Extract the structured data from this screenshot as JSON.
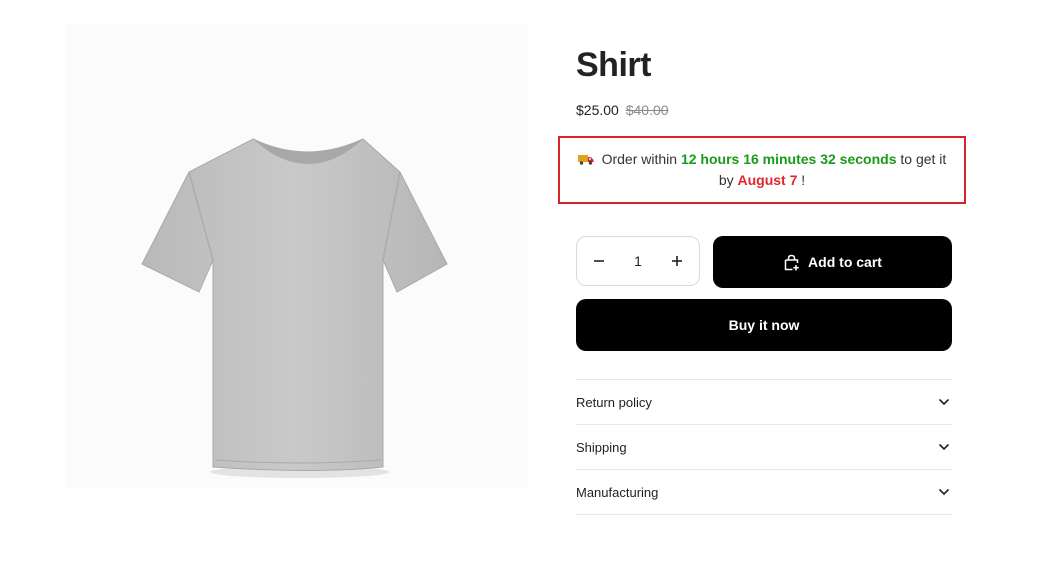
{
  "product": {
    "title": "Shirt",
    "price": "$25.00",
    "compare_price": "$40.00",
    "image_icon": "t-shirt-image"
  },
  "delivery": {
    "icon": "truck-icon",
    "prefix": "Order within",
    "timer": "12 hours 16 minutes 32 seconds",
    "middle": "to get it by",
    "date": "August 7",
    "suffix": "!",
    "border_color": "#d9232a",
    "timer_color": "#1a9a1a",
    "date_color": "#e0282e"
  },
  "quantity": {
    "minus_icon": "minus-icon",
    "value": "1",
    "plus_icon": "plus-icon"
  },
  "buttons": {
    "add_to_cart": "Add to cart",
    "add_to_cart_icon": "bag-plus-icon",
    "buy_now": "Buy it now"
  },
  "accordion": {
    "items": [
      {
        "label": "Return policy"
      },
      {
        "label": "Shipping"
      },
      {
        "label": "Manufacturing"
      }
    ],
    "icon": "chevron-down-icon"
  }
}
